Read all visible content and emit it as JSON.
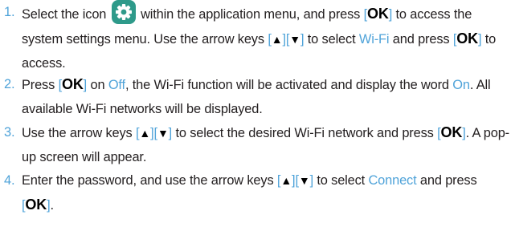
{
  "steps": [
    {
      "number": "1.",
      "parts": {
        "a": "Select the icon",
        "b": "within the application menu, and press",
        "c": "to access the system settings menu. Use the arrow keys",
        "d": "to select",
        "e": "Wi-Fi",
        "f": "and press",
        "g": "to access."
      }
    },
    {
      "number": "2.",
      "parts": {
        "a": "Press",
        "b": "on",
        "c": "Off",
        "d": ", the Wi-Fi function will be activated and display the word",
        "e": "On",
        "f": ". All available Wi-Fi networks will be displayed."
      }
    },
    {
      "number": "3.",
      "parts": {
        "a": "Use the arrow keys",
        "b": "to select the desired Wi-Fi network and press",
        "c": ". A pop-up screen will appear."
      }
    },
    {
      "number": "4.",
      "parts": {
        "a": "Enter the password, and use the arrow keys",
        "b": "to select",
        "c": "Connect",
        "d": "and press",
        "e": "."
      }
    }
  ],
  "tokens": {
    "ok": "OK",
    "open": "[",
    "close": "]",
    "up": "▲",
    "down": "▼"
  },
  "icon": "settings-gear-icon",
  "colors": {
    "accent": "#4fa3d9",
    "text": "#231f20",
    "icon_bg": "#2e9a8a"
  }
}
